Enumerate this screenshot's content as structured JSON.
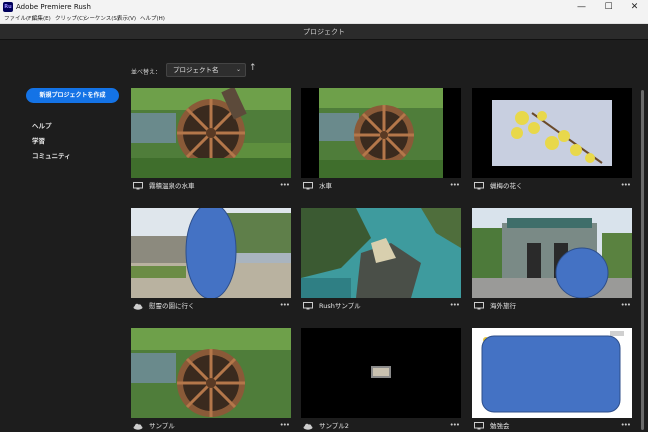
{
  "window": {
    "icon_text": "Ru",
    "title": "Adobe Premiere Rush",
    "minimize": "—",
    "maximize": "☐",
    "close": "✕"
  },
  "menu": [
    "ファイル(F)",
    "編集(E)",
    "クリップ(C)",
    "シーケンス(S)",
    "表示(V)",
    "ヘルプ(H)"
  ],
  "header": {
    "title": "プロジェクト"
  },
  "sidebar": {
    "new_project": "新規プロジェクトを作成",
    "links": [
      "ヘルプ",
      "学習",
      "コミュニティ"
    ]
  },
  "sort": {
    "label": "並べ替え：",
    "value": "プロジェクト名",
    "caret": "⌄",
    "direction": "↑"
  },
  "projects": [
    {
      "name": "霧積温泉の水車",
      "location": "local",
      "thumb": "waterwheel"
    },
    {
      "name": "水車",
      "location": "local",
      "thumb": "waterwheel-letterbox"
    },
    {
      "name": "蝋梅の花く",
      "location": "local",
      "thumb": "flowers"
    },
    {
      "name": "慰霊の園に行く",
      "location": "cloud",
      "thumb": "wall-redacted"
    },
    {
      "name": "Rushサンプル",
      "location": "local",
      "thumb": "aerial"
    },
    {
      "name": "海外旅行",
      "location": "local",
      "thumb": "temple-redacted"
    },
    {
      "name": "サンプル",
      "location": "cloud",
      "thumb": "waterwheel"
    },
    {
      "name": "サンプル2",
      "location": "cloud",
      "thumb": "black-small"
    },
    {
      "name": "勉強会",
      "location": "local",
      "thumb": "document-redacted"
    }
  ],
  "more_label": "•••",
  "colors": {
    "accent": "#1473e6",
    "redaction": "#4472c4",
    "background": "#1d1d1d"
  }
}
